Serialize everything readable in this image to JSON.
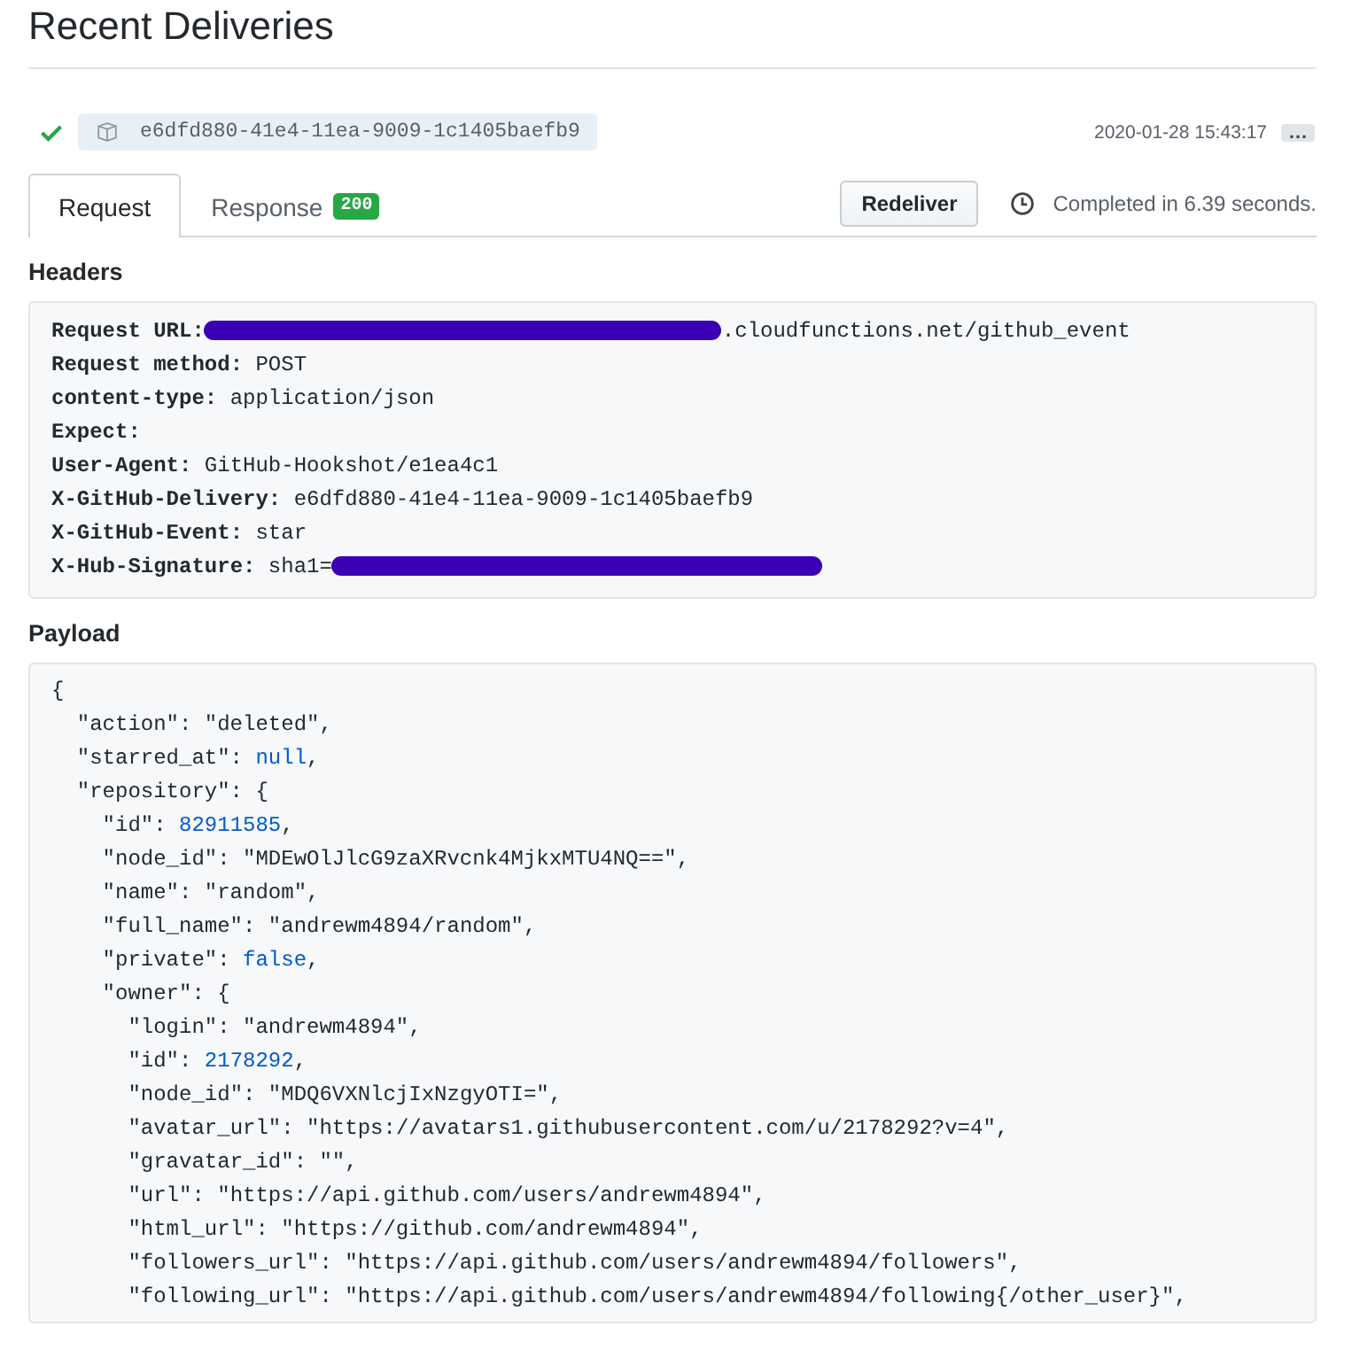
{
  "title": "Recent Deliveries",
  "delivery": {
    "success": true,
    "guid": "e6dfd880-41e4-11ea-9009-1c1405baefb9",
    "timestamp": "2020-01-28 15:43:17",
    "more_label": "…"
  },
  "tabs": [
    {
      "label": "Request",
      "selected": true
    },
    {
      "label": "Response",
      "selected": false,
      "badge": "200"
    }
  ],
  "redeliver_button": "Redeliver",
  "completed": "Completed in 6.39 seconds.",
  "headers": {
    "heading": "Headers",
    "lines": [
      {
        "name": "Request URL:",
        "value": ".cloudfunctions.net/github_event",
        "redacted_before": true
      },
      {
        "name": "Request method:",
        "value": "POST"
      },
      {
        "name": "content-type:",
        "value": "application/json"
      },
      {
        "name": "Expect:"
      },
      {
        "name": "User-Agent:",
        "value": "GitHub-Hookshot/e1ea4c1"
      },
      {
        "name": "X-GitHub-Delivery:",
        "value": "e6dfd880-41e4-11ea-9009-1c1405baefb9"
      },
      {
        "name": "X-GitHub-Event:",
        "value": "star"
      },
      {
        "name": "X-Hub-Signature:",
        "value": "sha1=",
        "redacted_after": true
      }
    ]
  },
  "payload": {
    "heading": "Payload",
    "root": {
      "value": "{",
      "children": [
        {
          "key": "\"action\": ",
          "value": "\"deleted\",",
          "kind": "string"
        },
        {
          "key": "\"starred_at\": ",
          "value": "null",
          "punct": ",",
          "kind": "literal"
        },
        {
          "key": "\"repository\": ",
          "value": "{",
          "children": [
            {
              "key": "\"id\": ",
              "value": "82911585",
              "punct": ",",
              "kind": "literal"
            },
            {
              "key": "\"node_id\": ",
              "value": "\"MDEwOlJlcG9zaXRvcnk4MjkxMTU4NQ==\",",
              "kind": "string"
            },
            {
              "key": "\"name\": ",
              "value": "\"random\",",
              "kind": "string"
            },
            {
              "key": "\"full_name\": ",
              "value": "\"andrewm4894/random\",",
              "kind": "string"
            },
            {
              "key": "\"private\": ",
              "value": "false",
              "punct": ",",
              "kind": "literal"
            },
            {
              "key": "\"owner\": ",
              "value": "{",
              "children": [
                {
                  "key": "\"login\": ",
                  "value": "\"andrewm4894\",",
                  "kind": "string"
                },
                {
                  "key": "\"id\": ",
                  "value": "2178292",
                  "punct": ",",
                  "kind": "literal"
                },
                {
                  "key": "\"node_id\": ",
                  "value": "\"MDQ6VXNlcjIxNzgyOTI=\",",
                  "kind": "string"
                },
                {
                  "key": "\"avatar_url\": ",
                  "value": "\"https://avatars1.githubusercontent.com/u/2178292?v=4\",",
                  "kind": "string"
                },
                {
                  "key": "\"gravatar_id\": ",
                  "value": "\"\",",
                  "kind": "string"
                },
                {
                  "key": "\"url\": ",
                  "value": "\"https://api.github.com/users/andrewm4894\",",
                  "kind": "string"
                },
                {
                  "key": "\"html_url\": ",
                  "value": "\"https://github.com/andrewm4894\",",
                  "kind": "string"
                },
                {
                  "key": "\"followers_url\": ",
                  "value": "\"https://api.github.com/users/andrewm4894/followers\",",
                  "kind": "string"
                },
                {
                  "key": "\"following_url\": ",
                  "value": "\"https://api.github.com/users/andrewm4894/following{/other_user}\",",
                  "kind": "string"
                }
              ]
            }
          ]
        }
      ]
    }
  }
}
